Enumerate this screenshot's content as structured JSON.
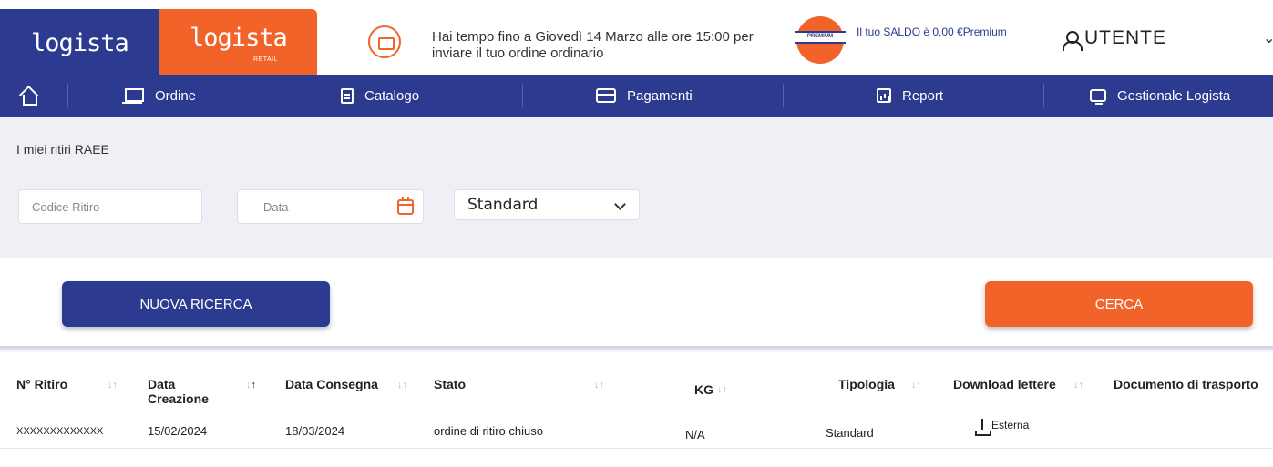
{
  "header": {
    "logo_main": "logista",
    "logo_retail": "logista",
    "logo_retail_sub": "RETAIL",
    "notice": "Hai tempo fino a Giovedì 14 Marzo alle ore 15:00 per inviare il tuo ordine ordinario",
    "premium_badge": "PREMIUM",
    "saldo": "Il tuo SALDO è 0,00 €Premium",
    "user": "UTENTE"
  },
  "nav": {
    "items": [
      {
        "label": "Ordine",
        "icon": "cart-icon"
      },
      {
        "label": "Catalogo",
        "icon": "document-icon"
      },
      {
        "label": "Pagamenti",
        "icon": "credit-card-icon"
      },
      {
        "label": "Report",
        "icon": "chart-icon"
      },
      {
        "label": "Gestionale Logista",
        "icon": "monitor-icon"
      }
    ]
  },
  "page": {
    "breadcrumb": "I miei ritiri RAEE"
  },
  "filters": {
    "codice_placeholder": "Codice Ritiro",
    "data_placeholder": "Data",
    "tipologia_value": "Standard"
  },
  "buttons": {
    "new_search": "NUOVA RICERCA",
    "search": "CERCA"
  },
  "table": {
    "headers": {
      "ritiro": "N° Ritiro",
      "creazione": "Data Creazione",
      "consegna": "Data Consegna",
      "stato": "Stato",
      "kg": "KG",
      "tipologia": "Tipologia",
      "download": "Download lettere",
      "ddt": "Documento di trasporto"
    },
    "rows": [
      {
        "ritiro": "XXXXXXXXXXXXX",
        "creazione": "15/02/2024",
        "consegna": "18/03/2024",
        "stato": "ordine di ritiro chiuso",
        "kg": "N/A",
        "tipologia": "Standard",
        "download": "Esterna"
      }
    ]
  },
  "colors": {
    "brand_blue": "#2c3b8f",
    "brand_orange": "#f2632a"
  }
}
